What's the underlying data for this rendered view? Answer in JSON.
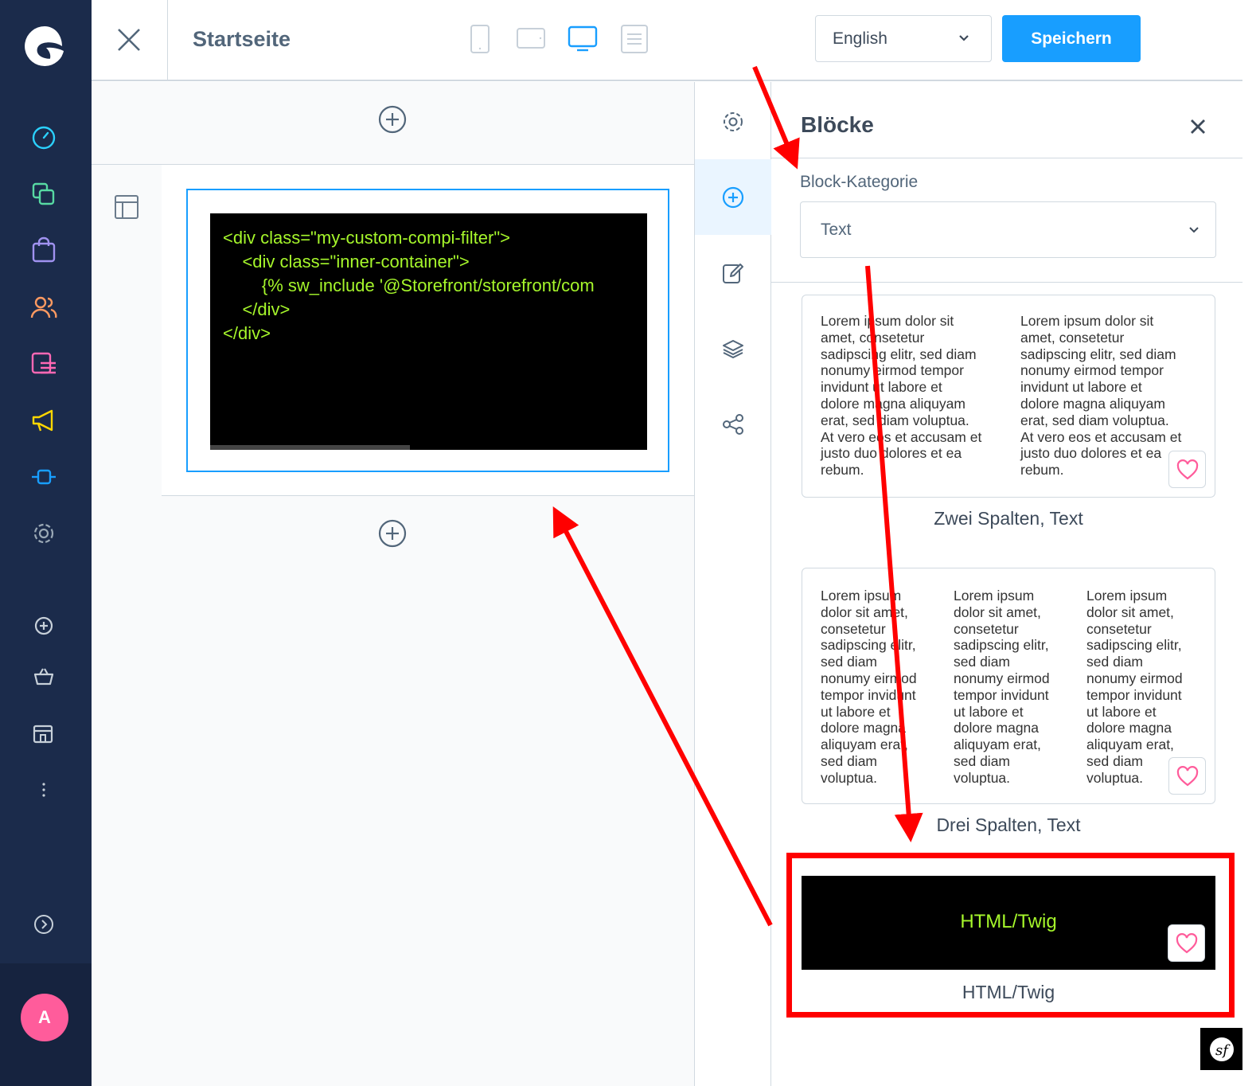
{
  "topbar": {
    "page_title": "Startseite",
    "language": "English",
    "save_label": "Speichern"
  },
  "editor": {
    "code_lines": [
      "<div class=\"my-custom-compi-filter\">",
      "    <div class=\"inner-container\">",
      "        {% sw_include '@Storefront/storefront/com",
      "    </div>",
      "</div>"
    ]
  },
  "panel": {
    "title": "Blöcke",
    "category_label": "Block-Kategorie",
    "category_value": "Text",
    "blocks": [
      {
        "label": "Zwei Spalten, Text",
        "columns": [
          [
            "Lorem ipsum dolor sit",
            "amet, consetetur",
            "sadipscing elitr, sed diam",
            "nonumy eirmod tempor",
            "invidunt ut labore et",
            "dolore magna aliquyam",
            "erat, sed diam voluptua.",
            "At vero eos et accusam et",
            "justo duo dolores et ea",
            "rebum."
          ],
          [
            "Lorem ipsum dolor sit",
            "amet, consetetur",
            "sadipscing elitr, sed diam",
            "nonumy eirmod tempor",
            "invidunt ut labore et",
            "dolore magna aliquyam",
            "erat, sed diam voluptua.",
            "At vero eos et accusam et",
            "justo duo dolores et ea",
            "rebum."
          ]
        ]
      },
      {
        "label": "Drei Spalten, Text",
        "columns": [
          [
            "Lorem ipsum",
            "dolor sit amet,",
            "consetetur",
            "sadipscing elitr,",
            "sed diam",
            "nonumy eirmod",
            "tempor invidunt",
            "ut labore et",
            "dolore magna",
            "aliquyam erat,",
            "sed diam",
            "voluptua."
          ],
          [
            "Lorem ipsum",
            "dolor sit amet,",
            "consetetur",
            "sadipscing elitr,",
            "sed diam",
            "nonumy eirmod",
            "tempor invidunt",
            "ut labore et",
            "dolore magna",
            "aliquyam erat,",
            "sed diam",
            "voluptua."
          ],
          [
            "Lorem ipsum",
            "dolor sit amet,",
            "consetetur",
            "sadipscing elitr,",
            "sed diam",
            "nonumy eirmod",
            "tempor invidunt",
            "ut labore et",
            "dolore magna",
            "aliquyam erat,",
            "sed diam",
            "voluptua."
          ]
        ]
      },
      {
        "label": "HTML/Twig",
        "preview_text": "HTML/Twig"
      }
    ]
  },
  "user": {
    "avatar_initial": "A"
  },
  "icons": {
    "nav": [
      "dashboard-icon",
      "catalogue-icon",
      "orders-icon",
      "customers-icon",
      "content-icon",
      "marketing-icon",
      "extensions-icon",
      "settings-icon",
      "add-icon",
      "basket-icon",
      "store-icon",
      "more-icon",
      "expand-icon"
    ],
    "tabs": [
      "settings-icon",
      "add-block-icon",
      "edit-icon",
      "layers-icon",
      "share-icon"
    ]
  },
  "colors": {
    "nav_bg": "#1b2b4b",
    "primary": "#189eff",
    "code_text": "#a6f72b",
    "annotation": "#ff0000",
    "favorite": "#ff5c9b"
  }
}
